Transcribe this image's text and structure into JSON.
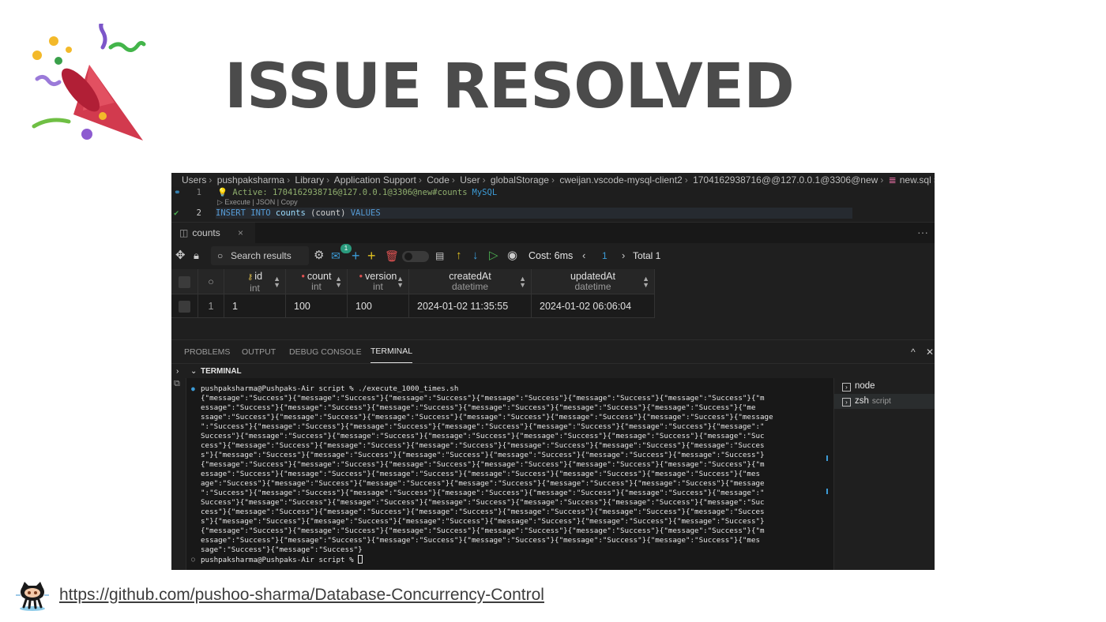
{
  "slide": {
    "title": "ISSUE RESOLVED",
    "link": "https://github.com/pushoo-sharma/Database-Concurrency-Control"
  },
  "breadcrumb": [
    "Users",
    "pushpaksharma",
    "Library",
    "Application Support",
    "Code",
    "User",
    "globalStorage",
    "cweijan.vscode-mysql-client2",
    "1704162938716@@127.0.0.1@3306@new",
    "new.sql",
    "..."
  ],
  "editor": {
    "line1_no": "1",
    "line1_text": "Active: 1704162938716@127.0.0.1@3306@new#counts",
    "line1_lang": "MySQL",
    "codelens": "Execute | JSON | Copy",
    "line2_no": "2",
    "line2_kw1": "INSERT INTO",
    "line2_table": "counts",
    "line2_cols": "(count)",
    "line2_kw2": "VALUES"
  },
  "tab": {
    "label": "counts",
    "close": "×",
    "more": "···"
  },
  "toolbar": {
    "search_placeholder": "Search results",
    "badge": "1",
    "cost": "Cost: 6ms",
    "page": "1",
    "total": "Total 1"
  },
  "grid": {
    "columns": [
      {
        "name": "id",
        "type": "int",
        "marker": "key"
      },
      {
        "name": "count",
        "type": "int",
        "marker": "required"
      },
      {
        "name": "version",
        "type": "int",
        "marker": "required"
      },
      {
        "name": "createdAt",
        "type": "datetime",
        "marker": ""
      },
      {
        "name": "updatedAt",
        "type": "datetime",
        "marker": ""
      }
    ],
    "rows": [
      {
        "index": "1",
        "id": "1",
        "count": "100",
        "version": "100",
        "createdAt": "2024-01-02 11:35:55",
        "updatedAt": "2024-01-02 06:06:04"
      }
    ]
  },
  "panel": {
    "tabs": [
      "PROBLEMS",
      "OUTPUT",
      "DEBUG CONSOLE",
      "TERMINAL"
    ],
    "active_tab": "TERMINAL",
    "section": "TERMINAL"
  },
  "terminal": {
    "command_line": "pushpaksharma@Pushpaks-Air script % ./execute_1000_times.sh",
    "output_lines": [
      "{\"message\":\"Success\"}{\"message\":\"Success\"}{\"message\":\"Success\"}{\"message\":\"Success\"}{\"message\":\"Success\"}{\"message\":\"Success\"}{\"m",
      "essage\":\"Success\"}{\"message\":\"Success\"}{\"message\":\"Success\"}{\"message\":\"Success\"}{\"message\":\"Success\"}{\"message\":\"Success\"}{\"me",
      "ssage\":\"Success\"}{\"message\":\"Success\"}{\"message\":\"Success\"}{\"message\":\"Success\"}{\"message\":\"Success\"}{\"message\":\"Success\"}{\"message",
      "\":\"Success\"}{\"message\":\"Success\"}{\"message\":\"Success\"}{\"message\":\"Success\"}{\"message\":\"Success\"}{\"message\":\"Success\"}{\"message\":\"",
      "Success\"}{\"message\":\"Success\"}{\"message\":\"Success\"}{\"message\":\"Success\"}{\"message\":\"Success\"}{\"message\":\"Success\"}{\"message\":\"Suc",
      "cess\"}{\"message\":\"Success\"}{\"message\":\"Success\"}{\"message\":\"Success\"}{\"message\":\"Success\"}{\"message\":\"Success\"}{\"message\":\"Succes",
      "s\"}{\"message\":\"Success\"}{\"message\":\"Success\"}{\"message\":\"Success\"}{\"message\":\"Success\"}{\"message\":\"Success\"}{\"message\":\"Success\"}",
      "{\"message\":\"Success\"}{\"message\":\"Success\"}{\"message\":\"Success\"}{\"message\":\"Success\"}{\"message\":\"Success\"}{\"message\":\"Success\"}{\"m",
      "essage\":\"Success\"}{\"message\":\"Success\"}{\"message\":\"Success\"}{\"message\":\"Success\"}{\"message\":\"Success\"}{\"message\":\"Success\"}{\"mes",
      "age\":\"Success\"}{\"message\":\"Success\"}{\"message\":\"Success\"}{\"message\":\"Success\"}{\"message\":\"Success\"}{\"message\":\"Success\"}{\"message",
      "\":\"Success\"}{\"message\":\"Success\"}{\"message\":\"Success\"}{\"message\":\"Success\"}{\"message\":\"Success\"}{\"message\":\"Success\"}{\"message\":\"",
      "Success\"}{\"message\":\"Success\"}{\"message\":\"Success\"}{\"message\":\"Success\"}{\"message\":\"Success\"}{\"message\":\"Success\"}{\"message\":\"Suc",
      "cess\"}{\"message\":\"Success\"}{\"message\":\"Success\"}{\"message\":\"Success\"}{\"message\":\"Success\"}{\"message\":\"Success\"}{\"message\":\"Succes",
      "s\"}{\"message\":\"Success\"}{\"message\":\"Success\"}{\"message\":\"Success\"}{\"message\":\"Success\"}{\"message\":\"Success\"}{\"message\":\"Success\"}",
      "{\"message\":\"Success\"}{\"message\":\"Success\"}{\"message\":\"Success\"}{\"message\":\"Success\"}{\"message\":\"Success\"}{\"message\":\"Success\"}{\"m",
      "essage\":\"Success\"}{\"message\":\"Success\"}{\"message\":\"Success\"}{\"message\":\"Success\"}{\"message\":\"Success\"}{\"message\":\"Success\"}{\"mes",
      "sage\":\"Success\"}{\"message\":\"Success\"}"
    ],
    "prompt": "pushpaksharma@Pushpaks-Air script % ",
    "sessions": [
      {
        "name": "node",
        "sub": ""
      },
      {
        "name": "zsh",
        "sub": "script"
      }
    ]
  },
  "colors": {
    "title_gray": "#4b4b4b",
    "sql_keyword": "#569cd6",
    "active_green": "#8fae6e",
    "accent_blue": "#3c9bd6",
    "badge_teal": "#2a9a7d"
  }
}
